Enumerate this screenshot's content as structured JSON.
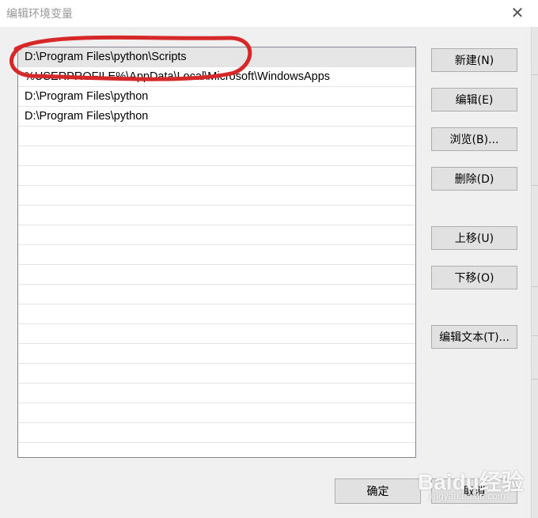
{
  "window": {
    "title": "编辑环境变量",
    "close_glyph": "✕"
  },
  "list": {
    "items": [
      "D:\\Program Files\\python\\Scripts",
      "%USERPROFILE%\\AppData\\Local\\Microsoft\\WindowsApps",
      "D:\\Program Files\\python",
      "D:\\Program Files\\python"
    ],
    "selected_index": 0
  },
  "buttons": {
    "new": "新建(N)",
    "edit": "编辑(E)",
    "browse": "浏览(B)...",
    "delete": "删除(D)",
    "move_up": "上移(U)",
    "move_down": "下移(O)",
    "edit_text": "编辑文本(T)...",
    "ok": "确定",
    "cancel": "取消"
  },
  "watermark": {
    "logo": "Baidu经验",
    "url": "jingyan.baidu.com"
  },
  "colors": {
    "annotation_stroke": "#d62828",
    "selected_row": "#e5e5e5"
  }
}
